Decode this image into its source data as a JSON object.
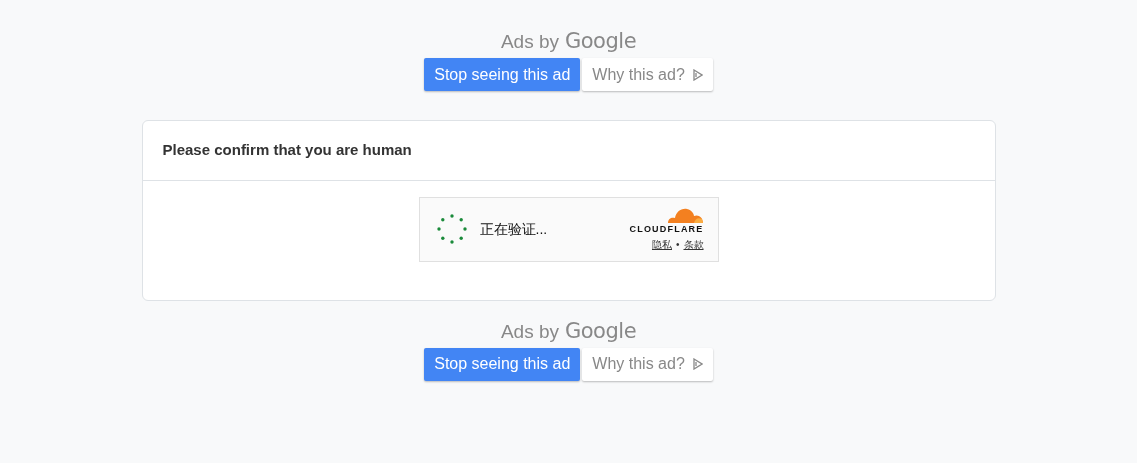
{
  "ad_blocks": [
    {
      "label": "Ads by",
      "brand": "Google",
      "buttons": [
        {
          "label": "Stop seeing this ad",
          "kind": "primary"
        },
        {
          "label": "Why this ad?",
          "kind": "info"
        }
      ]
    },
    {
      "label": "Ads by",
      "brand": "Google",
      "buttons": [
        {
          "label": "Stop seeing this ad",
          "kind": "primary"
        },
        {
          "label": "Why this ad?",
          "kind": "info"
        }
      ]
    }
  ],
  "card": {
    "title": "Please confirm that you are human",
    "captcha": {
      "status": "正在验证...",
      "brand": "CLOUDFLARE",
      "links": [
        "隐私",
        "条款"
      ],
      "separator": "•"
    }
  }
}
